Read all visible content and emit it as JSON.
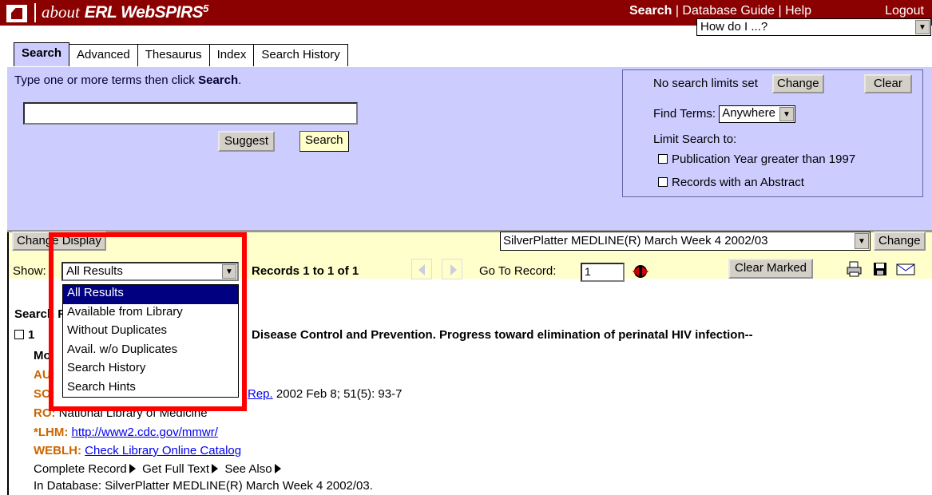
{
  "header": {
    "brand_about": "about",
    "brand_name": "ERL WebSPIRS",
    "brand_version": "5",
    "nav_search": "Search",
    "nav_sep1": " | ",
    "nav_database_guide": "Database Guide",
    "nav_sep2": " | ",
    "nav_help": "Help",
    "logout": "Logout"
  },
  "tabs": [
    {
      "label": "Search",
      "active": true
    },
    {
      "label": "Advanced"
    },
    {
      "label": "Thesaurus"
    },
    {
      "label": "Index"
    },
    {
      "label": "Search History"
    }
  ],
  "how_do_i": {
    "value": "How do I ...?"
  },
  "search": {
    "hint_prefix": "Type one or more terms then click ",
    "hint_bold": "Search",
    "hint_suffix": ".",
    "input_value": "",
    "suggest_label": "Suggest",
    "search_label": "Search"
  },
  "limits": {
    "status": "No search limits set",
    "change_label": "Change",
    "clear_label": "Clear",
    "find_terms_label": "Find Terms:",
    "find_terms_value": "Anywhere",
    "limit_to_label": "Limit Search to:",
    "option_year": "Publication Year greater than 1997",
    "option_abstract": "Records with an Abstract"
  },
  "display": {
    "change_display_label": "Change Display",
    "database_value": "SilverPlatter MEDLINE(R) March Week 4 2002/03",
    "database_change_label": "Change",
    "show_label": "Show:",
    "show_value": "All Results",
    "records_text": "Records 1 to 1 of 1",
    "goto_label": "Go To Record:",
    "goto_value": "1",
    "clear_marked_label": "Clear Marked"
  },
  "dropdown": {
    "options": [
      "All Results",
      "Available from Library",
      "Without Duplicates",
      "Avail. w/o Duplicates",
      "Search History",
      "Search Hints"
    ],
    "selected_index": 0
  },
  "results": {
    "section_title": "Search Results",
    "record_number": "1",
    "title_visible": "Disease Control and Prevention. Progress toward elimination of perinatal HIV infection--",
    "title_line2": "Mo",
    "au_tag": "AU:",
    "so_tag": "SO:",
    "so_link": "Rep.",
    "so_text": " 2002 Feb 8; 51(5): 93-7",
    "ro_tag": "RO:",
    "ro_text": "National Library of Medicine",
    "lhm_tag": "*LHM:",
    "lhm_link": "http://www2.cdc.gov/mmwr/",
    "weblh_tag": "WEBLH:",
    "weblh_link": "Check Library Online Catalog",
    "complete_record": "Complete Record",
    "get_full_text": "Get Full Text",
    "see_also": "See Also",
    "in_database": "In Database: SilverPlatter MEDLINE(R) March Week 4 2002/03."
  },
  "colors": {
    "topbar": "#8b0000",
    "panel": "#ccccff",
    "display_bar": "#ffffcc",
    "highlight": "#000080",
    "annotation": "#ff0000"
  }
}
